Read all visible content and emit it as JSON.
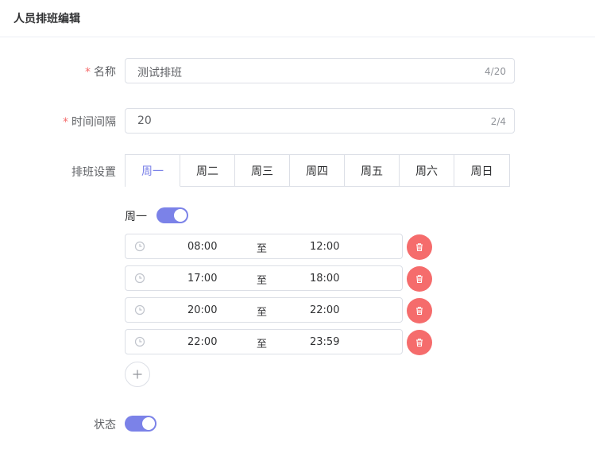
{
  "header": {
    "title": "人员排班编辑"
  },
  "form": {
    "name": {
      "label": "名称",
      "value": "测试排班",
      "count": "4/20"
    },
    "interval": {
      "label": "时间间隔",
      "value": "20",
      "count": "2/4"
    },
    "schedule": {
      "label": "排班设置",
      "tabs": [
        "周一",
        "周二",
        "周三",
        "周四",
        "周五",
        "周六",
        "周日"
      ],
      "active_tab": "周一",
      "day_label": "周一",
      "day_enabled": true,
      "ranges": [
        {
          "start": "08:00",
          "sep": "至",
          "end": "12:00"
        },
        {
          "start": "17:00",
          "sep": "至",
          "end": "18:00"
        },
        {
          "start": "20:00",
          "sep": "至",
          "end": "22:00"
        },
        {
          "start": "22:00",
          "sep": "至",
          "end": "23:59"
        }
      ]
    },
    "status": {
      "label": "状态",
      "enabled": true
    }
  },
  "colors": {
    "accent": "#7b82e8",
    "danger": "#f56c6c",
    "required": "#f56c6c"
  },
  "icons": {
    "time": "clock-icon",
    "delete": "trash-icon",
    "add": "plus-icon"
  }
}
